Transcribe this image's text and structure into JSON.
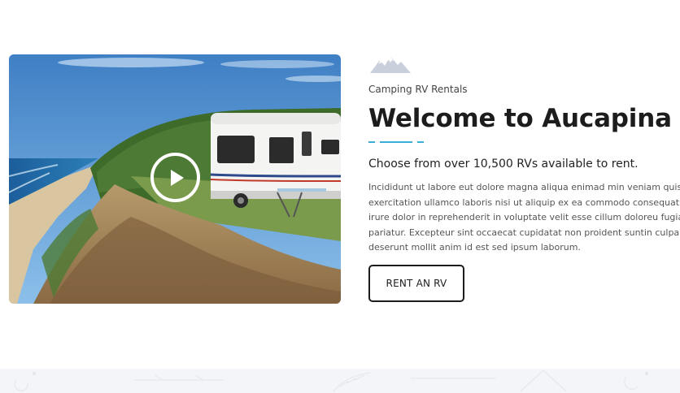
{
  "hero": {
    "alt_description": "",
    "play_icon": "play-icon"
  },
  "intro": {
    "logo_icon": "mountain-icon",
    "subtitle": "Camping RV Rentals",
    "title": "Welcome to Aucapina",
    "lead": "Choose from over 10,500 RVs available to rent.",
    "body_lines": [
      "Incididunt ut labore eut dolore magna aliqua enimad min veniam quis nostrud",
      "exercitation ullamco laboris nisi ut aliquip ex ea commodo consequat. Duis aute",
      "irure dolor in reprehenderit in voluptate velit esse cillum doloreu fugiat nulla",
      "pariatur. Excepteur sint occaecat cupidatat non proident suntin culpa qu officia",
      "deserunt mollit anim id est sed ipsum laborum."
    ],
    "cta_label": "RENT AN RV"
  },
  "colors": {
    "accent": "#3aaed8",
    "logo": "#c9d0dc",
    "footer_bg": "#f4f5f8"
  }
}
